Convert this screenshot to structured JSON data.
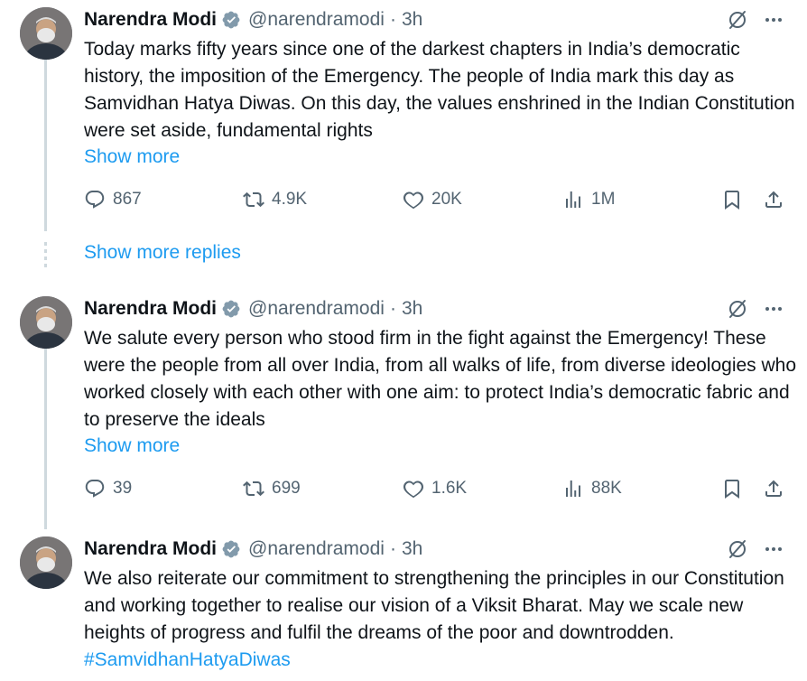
{
  "tweets": [
    {
      "name": "Narendra Modi",
      "handle": "@narendramodi",
      "separator": "·",
      "time": "3h",
      "text": "Today marks fifty years since one of the darkest chapters in India’s democratic history, the imposition of the Emergency. The people of India mark this day as Samvidhan Hatya Diwas. On this day, the values enshrined in the Indian Constitution were set aside, fundamental rights",
      "show_more": "Show more",
      "replies": "867",
      "reposts": "4.9K",
      "likes": "20K",
      "views": "1M"
    },
    {
      "name": "Narendra Modi",
      "handle": "@narendramodi",
      "separator": "·",
      "time": "3h",
      "text": "We salute every person who stood firm in the fight against the Emergency! These were the people from all over India, from all walks of life, from diverse ideologies who worked closely with each other with one aim: to protect India’s democratic fabric and to preserve the ideals",
      "show_more": "Show more",
      "replies": "39",
      "reposts": "699",
      "likes": "1.6K",
      "views": "88K"
    },
    {
      "name": "Narendra Modi",
      "handle": "@narendramodi",
      "separator": "·",
      "time": "3h",
      "text": "We also reiterate our commitment to strengthening the principles in our Constitution and working together to realise our vision of a Viksit Bharat. May we scale new heights of progress and fulfil the dreams of the poor and downtrodden. ",
      "hashtag": "#SamvidhanHatyaDiwas"
    }
  ],
  "show_more_replies": "Show more replies",
  "icons": {
    "verified": "verified-badge-icon",
    "grok": "grok-icon",
    "more": "more-dots-icon",
    "reply": "reply-icon",
    "repost": "repost-icon",
    "like": "heart-icon",
    "views": "views-icon",
    "bookmark": "bookmark-icon",
    "share": "share-icon"
  },
  "colors": {
    "accent": "#1d9bf0",
    "muted": "#536471",
    "text": "#0f1419",
    "badge": "#829aab"
  }
}
